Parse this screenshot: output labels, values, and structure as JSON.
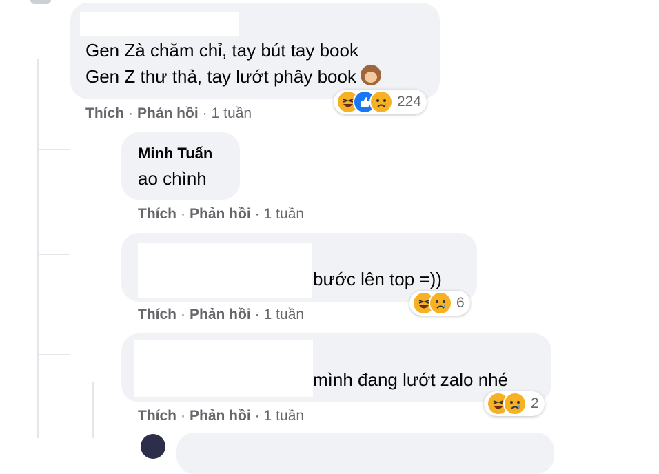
{
  "comments": [
    {
      "author": "",
      "lines": [
        "Gen Zà chăm chỉ, tay bút tay book",
        "Gen Z thư thả, tay lướt phây book"
      ],
      "line2_emoji": "monkey-icon",
      "actions": {
        "like": "Thích",
        "reply": "Phản hồi",
        "time": "1 tuần"
      },
      "reactions": {
        "icons": [
          "haha-icon",
          "like-icon",
          "sad-icon"
        ],
        "count": "224"
      }
    },
    {
      "author": "Minh Tuấn",
      "text": "ao chình",
      "actions": {
        "like": "Thích",
        "reply": "Phản hồi",
        "time": "1 tuần"
      }
    },
    {
      "author": "",
      "text": "bước lên top =))",
      "actions": {
        "like": "Thích",
        "reply": "Phản hồi",
        "time": "1 tuần"
      },
      "reactions": {
        "icons": [
          "haha-icon",
          "sad-icon"
        ],
        "count": "6"
      }
    },
    {
      "author": "",
      "text": "mình đang lướt zalo nhé",
      "actions": {
        "like": "Thích",
        "reply": "Phản hồi",
        "time": "1 tuần"
      },
      "reactions": {
        "icons": [
          "haha-icon",
          "sad-icon"
        ],
        "count": "2"
      }
    }
  ],
  "separator": "·",
  "colors": {
    "bubble": "#f0f2f5",
    "meta": "#65676b",
    "like_blue": "#1877f2",
    "emoji_yellow": "#f7b125"
  }
}
